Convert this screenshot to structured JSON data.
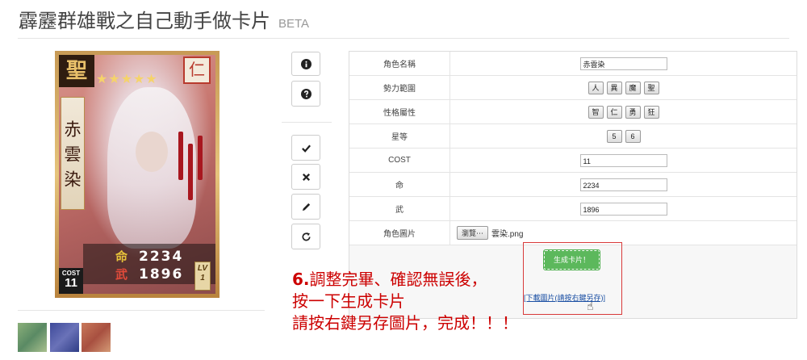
{
  "page": {
    "title": "霹靂群雄戰之自己動手做卡片",
    "beta": "BETA"
  },
  "card": {
    "grade_badge": "聖",
    "stars": "★★★★★",
    "attribute": "仁",
    "name": "赤雲染",
    "stat1_label": "命",
    "stat1_value": "2234",
    "stat2_label": "武",
    "stat2_value": "1896",
    "cost_label": "COST",
    "cost_value": "11",
    "lv_label": "LV",
    "lv_value": "1"
  },
  "thumbnails": [
    {
      "name": "green-texture",
      "color": "#6f9a6a"
    },
    {
      "name": "blue-texture",
      "color": "#4a5aa6"
    },
    {
      "name": "red-texture",
      "color": "#b9644e"
    }
  ],
  "tools": [
    {
      "name": "info-icon"
    },
    {
      "name": "question-icon"
    },
    {
      "name": "check-icon"
    },
    {
      "name": "close-icon"
    },
    {
      "name": "pencil-icon"
    },
    {
      "name": "refresh-icon"
    }
  ],
  "form": {
    "name_label": "角色名稱",
    "name_value": "赤雲染",
    "faction_label": "勢力範圍",
    "faction_options": [
      "人",
      "異",
      "魔",
      "聖"
    ],
    "trait_label": "性格屬性",
    "trait_options": [
      "智",
      "仁",
      "勇",
      "狂"
    ],
    "star_label": "星等",
    "star_options": [
      "5",
      "6"
    ],
    "cost_label": "COST",
    "cost_value": "11",
    "life_label": "命",
    "life_value": "2234",
    "force_label": "武",
    "force_value": "1896",
    "image_label": "角色圖片",
    "browse_label": "瀏覽⋯",
    "file_name": "雲染.png",
    "generate_label": "生成卡片！",
    "download_label": "[下載圖片(請按右鍵另存)]"
  },
  "instruction": {
    "number": "6.",
    "line1": "調整完畢、確認無誤後，",
    "line2": "按一下生成卡片",
    "line3": "請按右鍵另存圖片，完成！！！"
  }
}
